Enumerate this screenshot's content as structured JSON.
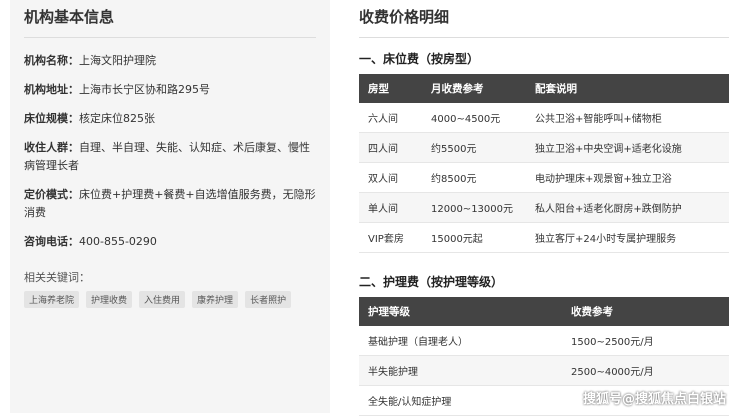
{
  "left": {
    "title": "机构基本信息",
    "rows": [
      {
        "label": "机构名称：",
        "value": "上海文阳护理院"
      },
      {
        "label": "机构地址：",
        "value": "上海市长宁区协和路295号"
      },
      {
        "label": "床位规模：",
        "value": "核定床位825张"
      },
      {
        "label": "收住人群：",
        "value": "自理、半自理、失能、认知症、术后康复、慢性病管理长者"
      },
      {
        "label": "定价模式：",
        "value": "床位费+护理费+餐费+自选增值服务费，无隐形消费"
      },
      {
        "label": "咨询电话：",
        "value": "400-855-0290"
      }
    ],
    "keywords_label": "相关关键词：",
    "keywords": [
      "上海养老院",
      "护理收费",
      "入住费用",
      "康养护理",
      "长者照护"
    ]
  },
  "right": {
    "title": "收费价格明细",
    "section1": {
      "title": "一、床位费（按房型）",
      "headers": [
        "房型",
        "月收费参考",
        "配套说明"
      ],
      "rows": [
        [
          "六人间",
          "4000~4500元",
          "公共卫浴+智能呼叫+储物柜"
        ],
        [
          "四人间",
          "约5500元",
          "独立卫浴+中央空调+适老化设施"
        ],
        [
          "双人间",
          "约8500元",
          "电动护理床+观景窗+独立卫浴"
        ],
        [
          "单人间",
          "12000~13000元",
          "私人阳台+适老化厨房+跌倒防护"
        ],
        [
          "VIP套房",
          "15000元起",
          "独立客厅+24小时专属护理服务"
        ]
      ]
    },
    "section2": {
      "title": "二、护理费（按护理等级）",
      "headers": [
        "护理等级",
        "收费参考"
      ],
      "rows": [
        [
          "基础护理（自理老人）",
          "1500~2500元/月"
        ],
        [
          "半失能护理",
          "2500~4000元/月"
        ],
        [
          "全失能/认知症护理",
          ""
        ]
      ]
    },
    "watermark": "搜狐号@搜狐焦点白银站"
  }
}
